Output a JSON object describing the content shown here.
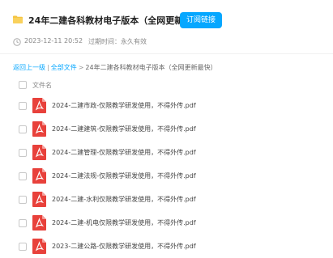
{
  "share": {
    "title": "24年二建各科教材电子版本（全网更新最...",
    "save_button": "订阅链接",
    "created_at": "2023-12-11 20:52",
    "expiry": "过期时间：永久有效"
  },
  "breadcrumb": {
    "back": "返回上一级",
    "separator": "|",
    "all_files": "全部文件",
    "arrow": ">",
    "current": "24年二建各科教材电子版本（全网更新最快）"
  },
  "file_table": {
    "column_header": "文件名",
    "files": [
      {
        "name": "2024-二建市政-仅限教学研发使用，不得外传.pdf",
        "icon": "pdf-icon"
      },
      {
        "name": "2024-二建建筑-仅限教学研发使用，不得外传.pdf",
        "icon": "pdf-icon"
      },
      {
        "name": "2024-二建管理-仅限教学研发使用，不得外传.pdf",
        "icon": "pdf-icon"
      },
      {
        "name": "2024-二建法规-仅限教学研发使用，不得外传.pdf",
        "icon": "pdf-icon"
      },
      {
        "name": "2024-二建-水利仅限教学研发使用，不得外传.pdf",
        "icon": "pdf-icon"
      },
      {
        "name": "2024-二建-机电仅限教学研发使用，不得外传.pdf",
        "icon": "pdf-icon"
      },
      {
        "name": "2023-二建公路-仅限教学研发使用，不得外传.pdf",
        "icon": "pdf-icon"
      }
    ]
  },
  "colors": {
    "accent": "#06a7ff",
    "pdf_red": "#e8413b",
    "folder_yellow": "#f5c443"
  }
}
